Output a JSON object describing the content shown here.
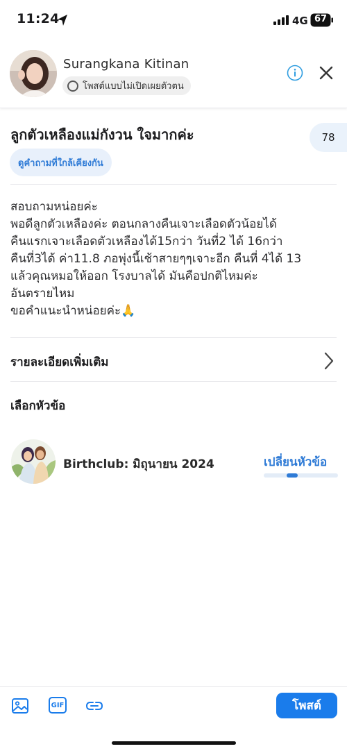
{
  "status_bar": {
    "time": "11:24",
    "network": "4G",
    "battery": "67"
  },
  "header": {
    "user_name": "Surangkana Kitinan",
    "anonymous_option": "โพสต์แบบไม่เปิดเผยตัวตน"
  },
  "post": {
    "title": "ลูกตัวเหลืองแม่กังวน ใจมากค่ะ",
    "char_count": "78",
    "similar_questions_label": "ดูคำถามที่ใกล้เคียงกัน",
    "body_lines": [
      "สอบถามหน่อยค่ะ",
      "พอดีลูกตัวเหลืองค่ะ ตอนกลางคืนเจาะเลือดตัวน้อยได้",
      "คืนแรกเจาะเลือดตัวเหลืองได้15กว่า วันที่2  ได้  16กว่า",
      "คืนที่3ได้ ค่า11.8   ภอพุ่งนี้เช้าสายๆๆเจาะอีก  คืนที่ 4ได้ 13",
      "แล้วคุณหมอให้ออก โรงบาลได้   มันคือปกติไหมค่ะ",
      "อันตรายไหม",
      "ขอคำแนะนำหน่อยค่ะ🙏"
    ],
    "more_details_label": "รายละเอียดเพิ่มเติม"
  },
  "topic": {
    "heading": "เลือกหัวข้อ",
    "name": "Birthclub: มิถุนายน 2024",
    "change_label": "เปลี่ยนหัวข้อ",
    "progress": 0.15
  },
  "toolbar": {
    "gif_label": "GIF",
    "post_label": "โพสต์"
  },
  "colors": {
    "accent": "#1a7ceb",
    "link": "#2f7bd6",
    "chip_bg": "#e8f0fb"
  }
}
